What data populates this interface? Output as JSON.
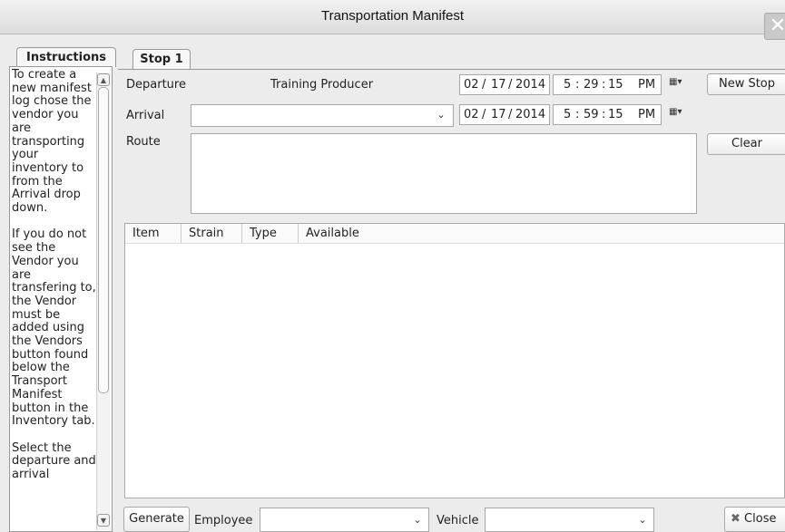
{
  "window": {
    "title": "Transportation Manifest",
    "close_glyph": "✕"
  },
  "sidebar": {
    "tab_label": "Instructions",
    "text": "To create a new manifest log chose the vendor you are transporting your inventory to from the Arrival drop down.\n\nIf you do not see the Vendor you are transfering to, the Vendor must be added using the Vendors button found below the Transport Manifest button in the Inventory tab.\n\nSelect the departure and arrival"
  },
  "main": {
    "tab_label": "Stop 1",
    "departure": {
      "label": "Departure",
      "value": "Training Producer"
    },
    "arrival": {
      "label": "Arrival",
      "value": ""
    },
    "route": {
      "label": "Route",
      "value": ""
    },
    "departure_dt": {
      "month": "02",
      "day": "17",
      "year": "2014",
      "hour": "5",
      "minute": "29",
      "second": "15",
      "ampm": "PM"
    },
    "arrival_dt": {
      "month": "02",
      "day": "17",
      "year": "2014",
      "hour": "5",
      "minute": "59",
      "second": "15",
      "ampm": "PM"
    },
    "new_stop_label": "New Stop",
    "clear_label": "Clear",
    "table": {
      "headers": [
        "Item",
        "Strain",
        "Type",
        "Available"
      ],
      "rows": []
    }
  },
  "footer": {
    "generate_label": "Generate",
    "employee_label": "Employee",
    "employee_value": "",
    "vehicle_label": "Vehicle",
    "vehicle_value": "",
    "close_label": "Close"
  }
}
